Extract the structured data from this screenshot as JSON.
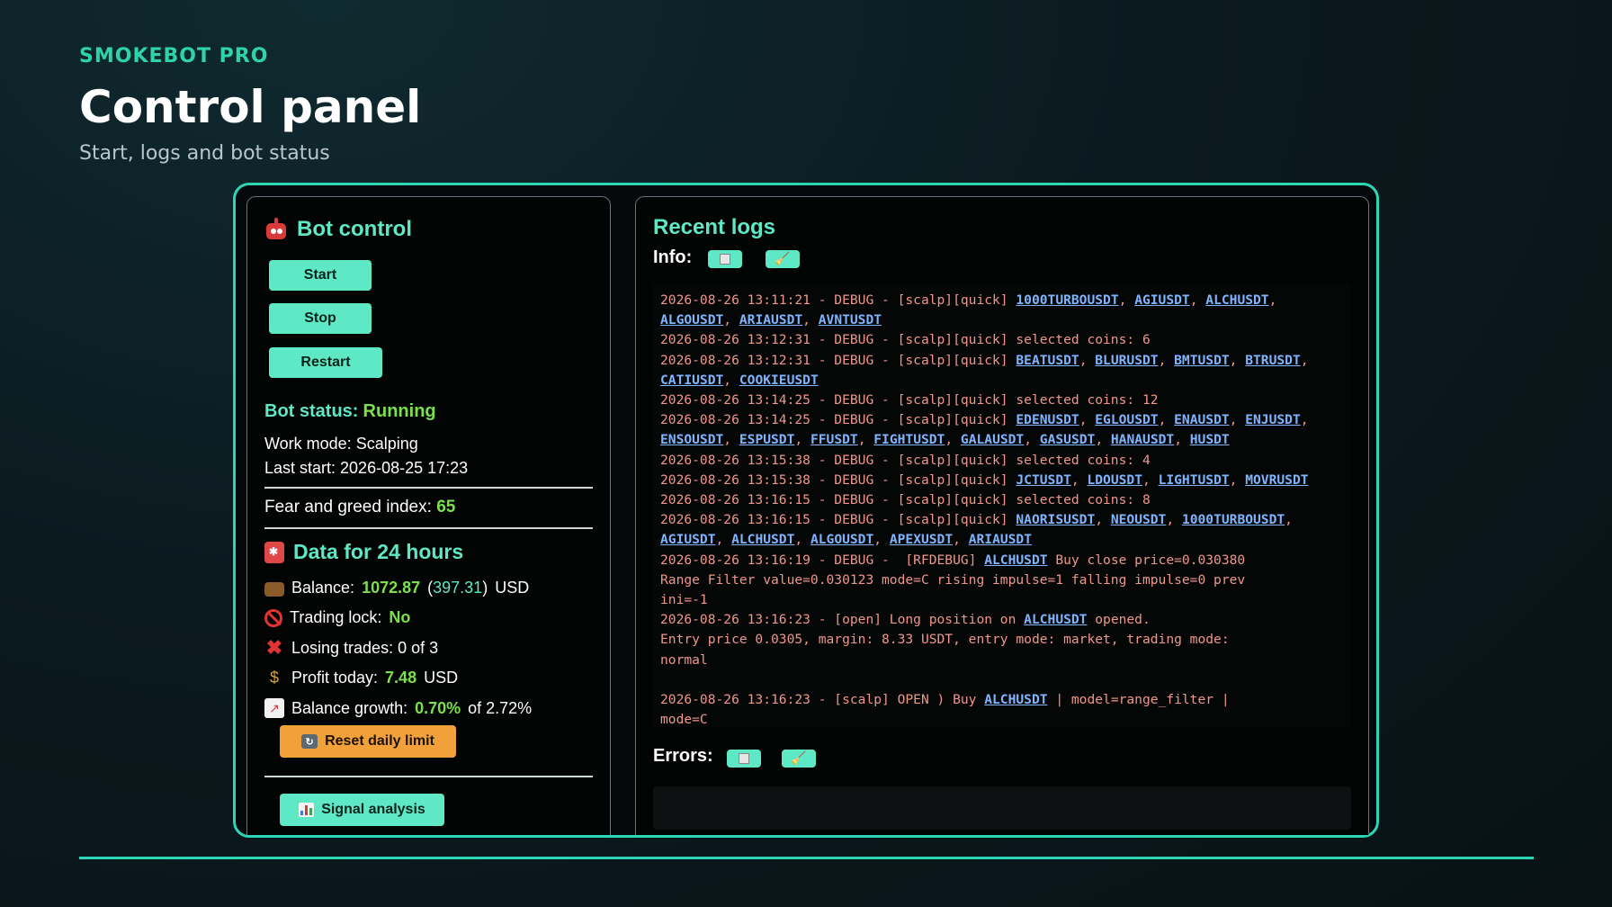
{
  "header": {
    "brand": "SMOKEBOT PRO",
    "title": "Control panel",
    "subtitle": "Start, logs and bot status"
  },
  "bot_control": {
    "title": "Bot control",
    "start_label": "Start",
    "stop_label": "Stop",
    "restart_label": "Restart",
    "status_label": "Bot status:",
    "status_value": "Running",
    "work_mode": "Work mode: Scalping",
    "last_start": "Last start: 2026-08-25 17:23",
    "fear_greed_label": "Fear and greed index:",
    "fear_greed_value": "65"
  },
  "daily": {
    "title": "Data for 24 hours",
    "balance_label": "Balance:",
    "balance_value": "1072.87",
    "balance_sub": "397.31",
    "balance_unit": "USD",
    "lock_label": "Trading lock:",
    "lock_value": "No",
    "losing_trades": "Losing trades: 0 of 3",
    "profit_label": "Profit today:",
    "profit_value": "7.48",
    "profit_unit": "USD",
    "growth_label": "Balance growth:",
    "growth_value": "0.70%",
    "growth_of": "of 2.72%",
    "reset_label": "Reset daily limit",
    "signal_label": "Signal analysis"
  },
  "logs": {
    "title": "Recent logs",
    "info_label": "Info:",
    "errors_label": "Errors:",
    "lines": [
      "2026-08-26 13:11:21 - DEBUG - [scalp][quick] ",
      "2026-08-26 13:12:31 - DEBUG - [scalp][quick] selected coins: 6",
      "2026-08-26 13:12:31 - DEBUG - [scalp][quick] ",
      "2026-08-26 13:14:25 - DEBUG - [scalp][quick] selected coins: 12",
      "2026-08-26 13:14:25 - DEBUG - [scalp][quick] ",
      "2026-08-26 13:15:38 - DEBUG - [scalp][quick] selected coins: 4",
      "2026-08-26 13:15:38 - DEBUG - [scalp][quick] ",
      "2026-08-26 13:16:15 - DEBUG - [scalp][quick] selected coins: 8",
      "2026-08-26 13:16:15 - DEBUG - [scalp][quick] ",
      "2026-08-26 13:16:19 - DEBUG -  [RFDEBUG] ",
      " Buy close price=0.030380",
      "Range Filter value=0.030123 mode=C rising impulse=1 falling impulse=0 prev",
      "ini=-1",
      "2026-08-26 13:16:23 - [open] Long position on ",
      " opened.",
      "Entry price 0.0305, margin: 8.33 USDT, entry mode: market, trading mode:",
      "normal",
      "2026-08-26 13:16:23 - [scalp] OPEN ) Buy ",
      " | model=range_filter |",
      "mode=C"
    ],
    "symbols": {
      "g1a": "1000TURBOUSDT",
      "g1b": "AGIUSDT",
      "g1c": "ALCHUSDT",
      "g1d": "ALGOUSDT",
      "g1e": "ARIAUSDT",
      "g1f": "AVNTUSDT",
      "g2a": "BEATUSDT",
      "g2b": "BLURUSDT",
      "g2c": "BMTUSDT",
      "g2d": "BTRUSDT",
      "g2e": "CATIUSDT",
      "g2f": "COOKIEUSDT",
      "g3a": "EDENUSDT",
      "g3b": "EGLOUSDT",
      "g3c": "ENAUSDT",
      "g3d": "ENJUSDT",
      "g3e": "ENSOUSDT",
      "g3f": "ESPUSDT",
      "g3g": "FFUSDT",
      "g3h": "FIGHTUSDT",
      "g3i": "GALAUSDT",
      "g3j": "GASUSDT",
      "g3k": "HANAUSDT",
      "g3l": "HUSDT",
      "g4a": "JCTUSDT",
      "g4b": "LDOUSDT",
      "g4c": "LIGHTUSDT",
      "g4d": "MOVRUSDT",
      "g5a": "NAORISUSDT",
      "g5b": "NEOUSDT",
      "g5c": "1000TURBOUSDT",
      "g5d": "AGIUSDT",
      "g5e": "ALCHUSDT",
      "g5f": "ALGOUSDT",
      "g5g": "APEXUSDT",
      "g5h": "ARIAUSDT",
      "rf": "ALCHUSDT",
      "open": "ALCHUSDT",
      "scalp": "ALCHUSDT"
    }
  },
  "colors": {
    "accent": "#5ee8c5",
    "brand": "#2fd3a8",
    "positive": "#7be04a",
    "warning": "#f2a13a",
    "log_text": "#f0968a",
    "symbol_link": "#7fb4ff"
  }
}
